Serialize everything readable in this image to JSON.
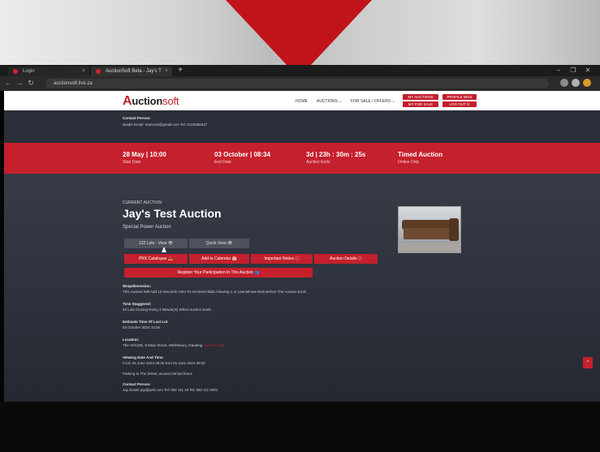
{
  "browser": {
    "tabs": [
      {
        "label": "Login"
      },
      {
        "label": "AuctionSoft Beta - Jay's T"
      }
    ],
    "new_tab": "+",
    "tab_close": "×",
    "url": "auctionsoft.live.za",
    "nav": {
      "back": "←",
      "forward": "→",
      "reload": "↻"
    },
    "window": {
      "min": "–",
      "max": "❐",
      "close": "✕"
    }
  },
  "site": {
    "logo": {
      "first": "A",
      "rest": "uction",
      "suffix": "soft"
    },
    "nav": [
      {
        "label": "HOME"
      },
      {
        "label": "AUCTIONS ⌄"
      },
      {
        "label": "FOR SALE / OFFERS ⌄"
      }
    ],
    "header_buttons": [
      {
        "label": "MY AUCTIONS"
      },
      {
        "label": "PROFILE BIDS"
      },
      {
        "label": "MY FOR SALE"
      },
      {
        "label": "LOG OUT ⏻"
      }
    ],
    "top_contact": {
      "heading": "Contact Person:",
      "details": "Diadie   Email: mancrist@gmail.com    Tel: 0123456347"
    },
    "band": [
      {
        "value": "28 May | 10:00",
        "label": "Start Date"
      },
      {
        "value": "03 October | 08:34",
        "label": "End Date"
      },
      {
        "value": "3d | 23h : 30m : 25s",
        "label": "Auction Ends"
      },
      {
        "value": "Timed Auction",
        "label": "Online Only"
      }
    ],
    "auction": {
      "current_label": "CURRENT AUCTION",
      "title": "Jay's Test Auction",
      "subtitle": "Special Power Auction",
      "grey_buttons": [
        "132 Lots - View 👁",
        "Quick View 👁"
      ],
      "red_buttons": [
        "PRX Catalogue 📥",
        "Add to Calendar 📅",
        "Important Notice ⓘ",
        "Auction Details ⓘ"
      ],
      "register": "Register Your Participation In This Auction 👥"
    },
    "details": [
      {
        "heading": "Wrapdimension:",
        "text": "This Auction Will Add 10 Seconds Onto To Imminent Bids Allowing 1 or Last Minute Bids Before The Auction Ends"
      },
      {
        "heading": "Time Staggered:",
        "text": "20 Lots Closing Every 3 Minute(S) When Auction Ends"
      },
      {
        "heading": "Estimate Time Of Last Lot",
        "text": "03 October 2024 15:26"
      },
      {
        "heading": "Location:",
        "text": "The HOUSE, 5 Main Street, Wellesbury, Gauteng",
        "link": "View on map"
      },
      {
        "heading": "Viewing Date And Time:",
        "text": "From 05 June 2024 08:00    End 25 June 2024 08:00"
      },
      {
        "heading": "",
        "text": "Parking In The Street, access behind fence"
      },
      {
        "heading": "Contact Person:",
        "text": "Jay   Email: jay@jwel.com    Tel: 082 111 19    Tel: 082 111 0001"
      }
    ],
    "scroll_top": "^"
  }
}
